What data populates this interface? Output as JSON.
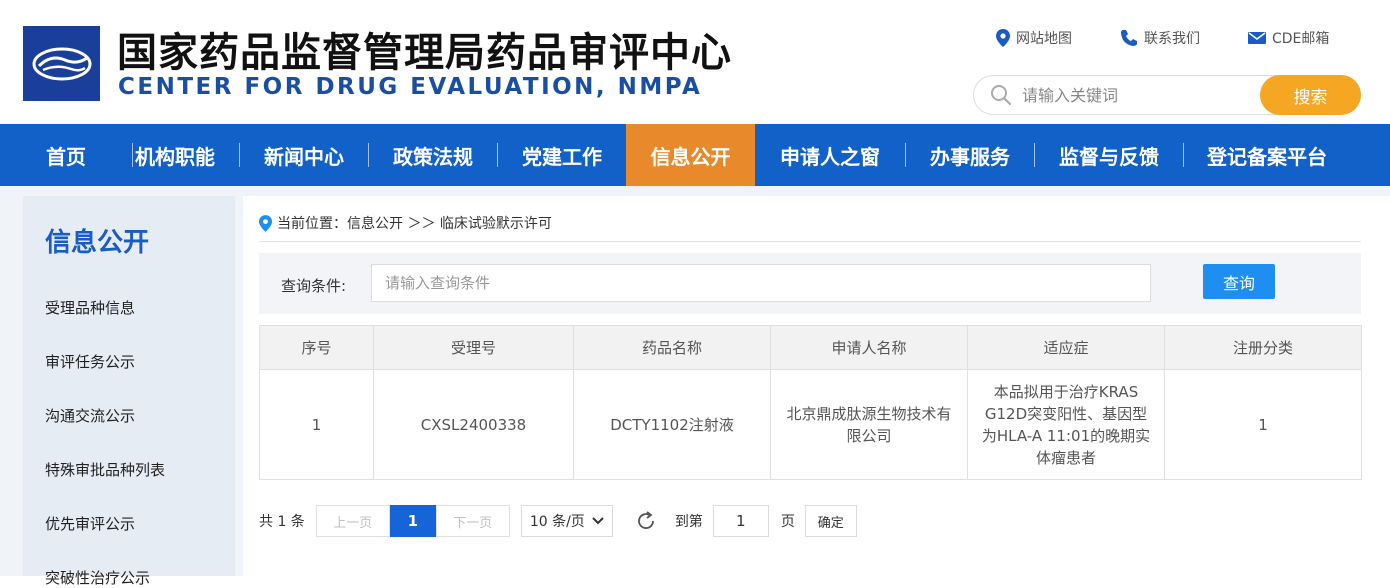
{
  "header": {
    "title": "国家药品监督管理局药品审评中心",
    "subtitle": "CENTER FOR DRUG EVALUATION, NMPA",
    "links": {
      "sitemap": "网站地图",
      "contact": "联系我们",
      "email": "CDE邮箱"
    },
    "search": {
      "placeholder": "请输入关键词",
      "button": "搜索"
    }
  },
  "nav": {
    "items": [
      "首页",
      "机构职能",
      "新闻中心",
      "政策法规",
      "党建工作",
      "信息公开",
      "申请人之窗",
      "办事服务",
      "监督与反馈",
      "登记备案平台"
    ],
    "active": "信息公开",
    "active_color": "#e8892b",
    "bar_color": "#1261c9"
  },
  "sidebar": {
    "title": "信息公开",
    "items": [
      "受理品种信息",
      "审评任务公示",
      "沟通交流公示",
      "特殊审批品种列表",
      "优先审评公示",
      "突破性治疗公示"
    ]
  },
  "breadcrumb": {
    "text": "当前位置：信息公开 ＞＞ 临床试验默示许可"
  },
  "query": {
    "label": "查询条件:",
    "placeholder": "请输入查询条件",
    "button": "查询"
  },
  "table": {
    "headers": [
      "序号",
      "受理号",
      "药品名称",
      "申请人名称",
      "适应症",
      "注册分类"
    ],
    "rows": [
      [
        "1",
        "CXSL2400338",
        "DCTY1102注射液",
        "北京鼎成肽源生物技术有限公司",
        "本品拟用于治疗KRAS G12D突变阳性、基因型为HLA-A 11:01的晚期实体瘤患者",
        "1"
      ]
    ]
  },
  "pager": {
    "total": "共 1 条",
    "prev": "上一页",
    "current": "1",
    "next": "下一页",
    "page_size": "10 条/页",
    "goto_label": "到第",
    "goto_value": "1",
    "page_unit": "页",
    "confirm": "确定"
  }
}
